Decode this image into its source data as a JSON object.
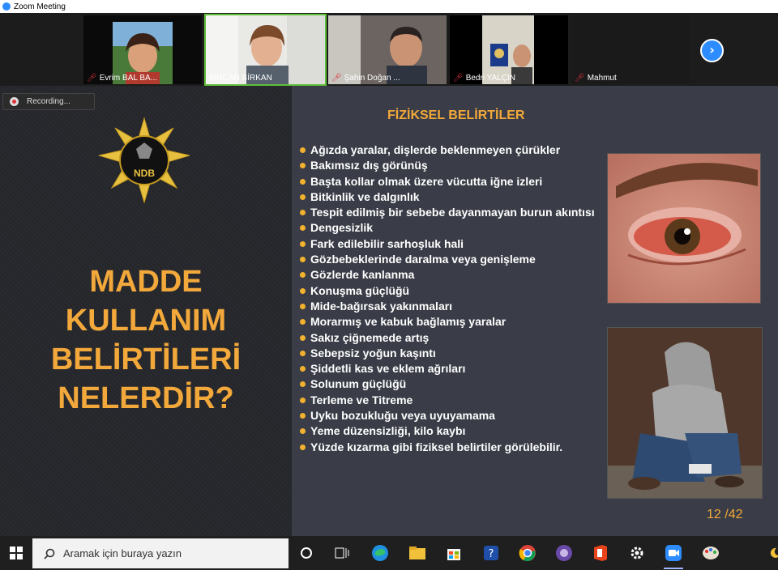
{
  "window": {
    "title": "Zoom Meeting"
  },
  "participants": [
    {
      "name": "Evrim BAL BA...",
      "muted": true
    },
    {
      "name": "BİRCAN BİRKAN",
      "muted": false,
      "active": true
    },
    {
      "name": "Şahin Doğan ...",
      "muted": true
    },
    {
      "name": "Bedri YALÇIN",
      "muted": true
    },
    {
      "name": "Mahmut",
      "muted": true
    }
  ],
  "recording": {
    "label": "Recording..."
  },
  "slide": {
    "badge_text": "NDB",
    "title_lines": [
      "MADDE",
      "KULLANIM",
      "BELİRTİLERİ",
      "NELERDİR?"
    ],
    "section_title": "FİZİKSEL BELİRTİLER",
    "symptoms": [
      "Ağızda yaralar, dişlerde beklenmeyen çürükler",
      "Bakımsız dış görünüş",
      "Başta kollar olmak üzere vücutta iğne izleri",
      "Bitkinlik ve dalgınlık",
      "Tespit edilmiş bir sebebe dayanmayan burun akıntısı",
      "Dengesizlik",
      "Fark edilebilir sarhoşluk hali",
      "Gözbebeklerinde daralma veya genişleme",
      "Gözlerde kanlanma",
      "Konuşma güçlüğü",
      "Mide-bağırsak yakınmaları",
      "Morarmış ve kabuk bağlamış yaralar",
      "Sakız çiğnemede artış",
      "Sebepsiz yoğun kaşıntı",
      "Şiddetli kas ve eklem ağrıları",
      "Solunum güçlüğü",
      "Terleme ve Titreme",
      "Uyku bozukluğu veya uyuyamama",
      "Yeme düzensizliği, kilo kaybı",
      "Yüzde kızarma gibi fiziksel belirtiler görülebilir."
    ],
    "page_indicator": "12 /42"
  },
  "taskbar": {
    "search_placeholder": "Aramak için buraya yazın",
    "icons": [
      "cortana-icon",
      "task-view-icon",
      "edge-icon",
      "file-explorer-icon",
      "store-icon",
      "help-icon",
      "chrome-icon",
      "app-icon",
      "office-icon",
      "settings-icon",
      "zoom-icon",
      "paint-icon",
      "night-light-icon"
    ]
  },
  "colors": {
    "accent": "#f2a83a",
    "zoom_blue": "#2d8cff",
    "mic_muted": "#e0303c",
    "active_border": "#5fbf3a"
  }
}
